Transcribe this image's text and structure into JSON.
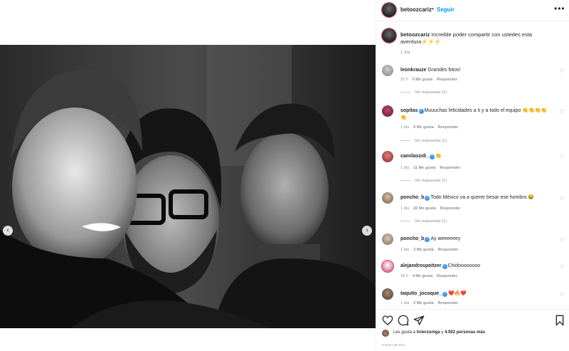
{
  "post": {
    "username": "betoozcariz",
    "dot": "•",
    "follow_label": "Seguir",
    "more_label": "•••",
    "caption_user": "betoozcariz",
    "caption_text": "Increible poder compartir con ustedes esta aventura⚡⚡⚡",
    "caption_time": "1 día",
    "likes_prefix": "Les gusta a",
    "likes_user": "livierzuniga",
    "likes_suffix": "y",
    "likes_count": "4.002 personas más",
    "post_time": "HACE UN DÍA"
  },
  "comments": [
    {
      "user": "leonkrauze",
      "verified": false,
      "text": "Grandes fotos!",
      "time": "22 h",
      "likes": "5 Me gusta",
      "reply": "Responder",
      "replies": "Ver respuestas (1)"
    },
    {
      "user": "sopitas",
      "verified": true,
      "text": "Muuuchas felicidades a ti y a todo el equipo 👏👏👏👏👏",
      "time": "1 día",
      "likes": "5 Me gusta",
      "reply": "Responder",
      "replies": "Ver respuestas (1)"
    },
    {
      "user": "camilasodi_",
      "verified": true,
      "text": "👏",
      "time": "1 día",
      "likes": "11 Me gusta",
      "reply": "Responder",
      "replies": "Ver respuestas (1)"
    },
    {
      "user": "poncho_b",
      "verified": true,
      "text": "Todo México va a querer besar ese hombro 😂",
      "time": "1 día",
      "likes": "32 Me gusta",
      "reply": "Responder",
      "replies": "Ver respuestas (1)"
    },
    {
      "user": "poncho_b",
      "verified": true,
      "text": "Ay weeeeeey",
      "time": "1 día",
      "likes": "3 Me gusta",
      "reply": "Responder",
      "replies": ""
    },
    {
      "user": "alejandrospeitzer",
      "verified": true,
      "text": "Chidoooooooo",
      "time": "18 h",
      "likes": "4 Me gusta",
      "reply": "Responder",
      "replies": ""
    },
    {
      "user": "taquito_jocoque_",
      "verified": true,
      "text": "❤️🔥❤️",
      "time": "1 día",
      "likes": "2 Me gusta",
      "reply": "Responder",
      "replies": ""
    }
  ],
  "icons": {
    "heart": "♡",
    "prev": "‹",
    "next": "›",
    "check": "✓"
  },
  "colors": {
    "link_blue": "#0095f6",
    "verified_blue": "#3897f0",
    "muted": "#8e8e8e"
  }
}
